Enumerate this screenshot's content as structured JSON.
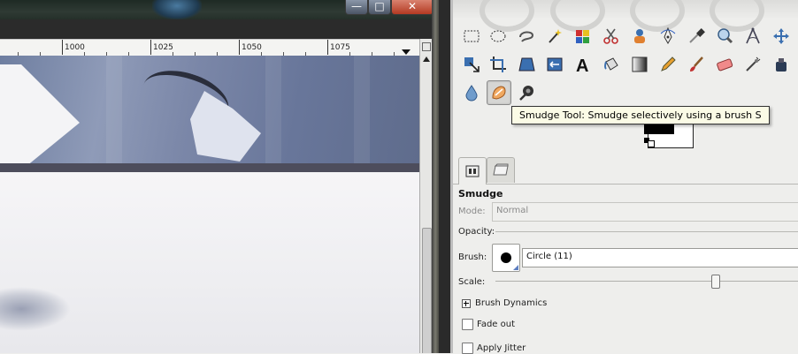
{
  "image_window": {
    "ruler": {
      "ticks": [
        "1000",
        "1025",
        "1050",
        "1075"
      ]
    },
    "window_buttons": {
      "minimize": "—",
      "maximize": "□",
      "close": "✕"
    }
  },
  "toolbox": {
    "tools_row1": [
      "rect-select-icon",
      "ellipse-select-icon",
      "free-select-icon",
      "fuzzy-select-icon",
      "color-select-icon",
      "scissors-select-icon",
      "foreground-select-icon",
      "paths-icon",
      "color-picker-icon",
      "zoom-icon",
      "measure-icon",
      "move-icon"
    ],
    "tools_row2": [
      "align-icon",
      "crop-icon",
      "rotate-icon",
      "scale-icon",
      "text-icon",
      "bucket-fill-icon",
      "blend-icon",
      "pencil-icon",
      "paintbrush-icon",
      "eraser-icon",
      "airbrush-icon",
      "ink-icon"
    ],
    "tools_row3": [
      "blur-sharpen-icon",
      "smudge-icon",
      "dodge-burn-icon"
    ],
    "tooltip": "Smudge Tool: Smudge selectively using a brush  S",
    "colors": {
      "foreground": "#000000",
      "background": "#ffffff"
    }
  },
  "tool_options": {
    "title": "Smudge",
    "mode_label": "Mode:",
    "mode_value": "Normal",
    "opacity_label": "Opacity:",
    "brush_label": "Brush:",
    "brush_value": "Circle (11)",
    "scale_label": "Scale:",
    "brush_dynamics_label": "Brush Dynamics",
    "fade_out_label": "Fade out",
    "apply_jitter_label": "Apply Jitter"
  }
}
